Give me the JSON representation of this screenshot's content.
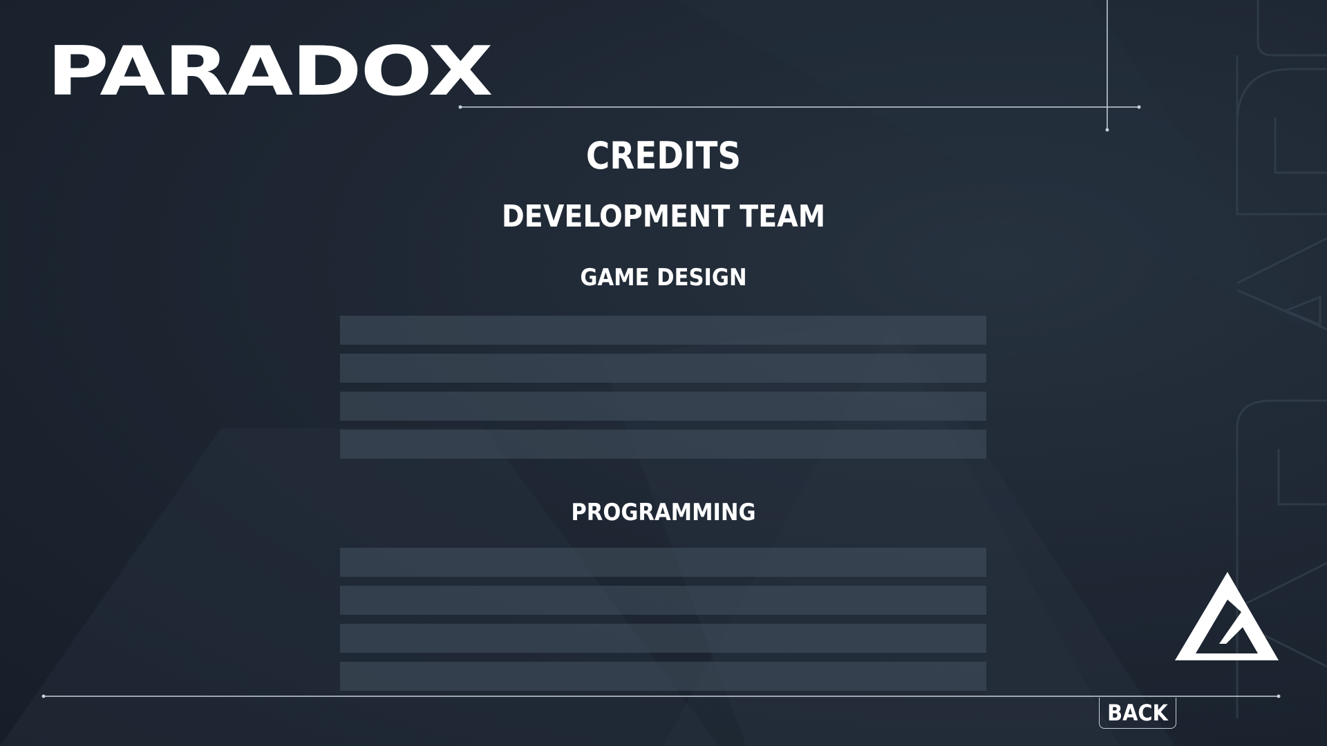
{
  "header": {
    "logo_text": "PARADOX"
  },
  "credits": {
    "title": "CREDITS",
    "team_title": "DEVELOPMENT TEAM",
    "sections": [
      {
        "title": "GAME DESIGN",
        "entries": 4
      },
      {
        "title": "PROGRAMMING",
        "entries": 4
      }
    ]
  },
  "footer": {
    "back_label": "BACK"
  },
  "colors": {
    "background": "#1c2531",
    "bar": "#3a4553",
    "accent": "#ffffff",
    "hud_line": "#c9d1da"
  },
  "icons": {
    "emblem": "triangle-logo-icon"
  }
}
